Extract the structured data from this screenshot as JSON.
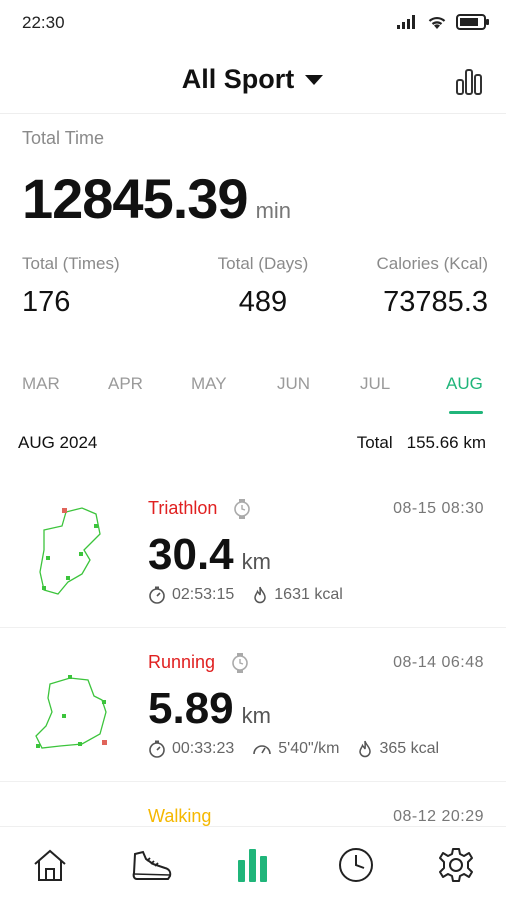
{
  "status_bar": {
    "time": "22:30"
  },
  "header": {
    "title": "All Sport"
  },
  "summary": {
    "total_time_label": "Total Time",
    "total_time_value": "12845.39",
    "total_time_unit": "min",
    "columns": [
      {
        "label": "Total (Times)",
        "value": "176"
      },
      {
        "label": "Total (Days)",
        "value": "489"
      },
      {
        "label": "Calories (Kcal)",
        "value": "73785.3"
      }
    ]
  },
  "months": {
    "tabs": [
      "MAR",
      "APR",
      "MAY",
      "JUN",
      "JUL",
      "AUG"
    ],
    "active": "AUG"
  },
  "month_summary": {
    "label": "AUG 2024",
    "total_label": "Total",
    "total_value": "155.66 km"
  },
  "activities": [
    {
      "type": "Triathlon",
      "color": "#e02020",
      "datetime": "08-15  08:30",
      "distance": "30.4",
      "unit": "km",
      "duration": "02:53:15",
      "calories": "1631 kcal"
    },
    {
      "type": "Running",
      "color": "#e02020",
      "datetime": "08-14  06:48",
      "distance": "5.89",
      "unit": "km",
      "duration": "00:33:23",
      "pace": "5'40\"/km",
      "calories": "365 kcal"
    },
    {
      "type": "Walking",
      "color": "#f5b800",
      "datetime": "08-12  20:29"
    }
  ],
  "colors": {
    "accent": "#20b57a",
    "route": "#3cc43c"
  },
  "nav": [
    "home-icon",
    "shoe-icon",
    "stats-icon",
    "clock-icon",
    "gear-icon"
  ]
}
